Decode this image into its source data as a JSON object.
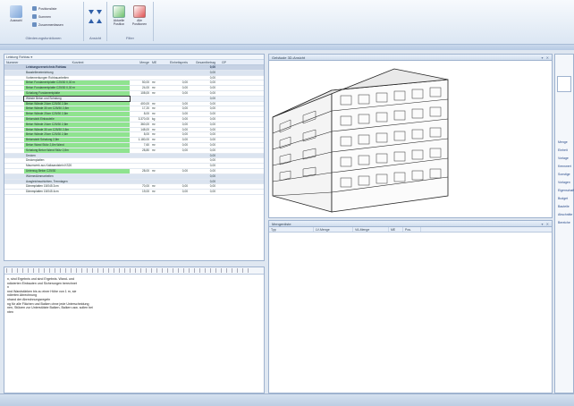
{
  "ribbon": {
    "groups": [
      {
        "label": "Gliederungsfunktionen",
        "big_button": "Auswahl",
        "small_buttons": [
          "Positionsliste",
          "Summen",
          "Zusammenfassen"
        ]
      },
      {
        "label": "Ansicht",
        "small_buttons": [],
        "big_button": ""
      },
      {
        "label": "Filter",
        "big_buttons": [
          "Aktuelle Position",
          "Alle Positionen"
        ]
      }
    ]
  },
  "table_panel": {
    "toolbar_value": "Leistung Rohbau",
    "columns": [
      "Nummer",
      "Kurztext",
      "Menge",
      "ME",
      "Einheitspreis",
      "Gesamtbetrag",
      "GP"
    ],
    "rows": [
      {
        "type": "sec",
        "text": "Leistungsverzeichnis Rohbau",
        "total": "0,00"
      },
      {
        "type": "sub",
        "text": "Baustelleneinrichtung",
        "total": "0,00"
      },
      {
        "type": "plain",
        "text": "Vorbemerkungen Rohbauarbeiten",
        "total": "0,00"
      },
      {
        "type": "grn",
        "text": "Beton Fundamentplatte C25/30 0,30 m",
        "qty": "50,00",
        "unit": "m²",
        "ep": "0,00",
        "total": "0,00"
      },
      {
        "type": "grn",
        "text": "Beton Fundamentplatte C25/30 0,30 m",
        "qty": "24,00",
        "unit": "m²",
        "ep": "0,00",
        "total": "0,00"
      },
      {
        "type": "grn",
        "text": "Schalung Fundamentplatte",
        "qty": "108,00",
        "unit": "m²",
        "ep": "0,00",
        "total": "0,00"
      },
      {
        "type": "sel",
        "text": "Wände Beton und Schalung",
        "total": "0,00"
      },
      {
        "type": "grn",
        "text": "Beton Wände 24cm C25/30 2,8m",
        "qty": "400,00",
        "unit": "m²",
        "ep": "0,00",
        "total": "0,00"
      },
      {
        "type": "grn",
        "text": "Beton Wände 30 cm C25/30 2,8m",
        "qty": "17,20",
        "unit": "m²",
        "ep": "0,00",
        "total": "0,00"
      },
      {
        "type": "grn",
        "text": "Beton Wände 20cm C25/30 2,8m",
        "qty": "8,00",
        "unit": "m²",
        "ep": "0,00",
        "total": "0,00"
      },
      {
        "type": "grn",
        "text": "Betonstahl Einbauteile",
        "qty": "3.370,00",
        "unit": "kg",
        "ep": "0,00",
        "total": "0,00"
      },
      {
        "type": "grn",
        "text": "Beton Wände 24cm C25/30 2,8m",
        "qty": "360,00",
        "unit": "m²",
        "ep": "0,00",
        "total": "0,00"
      },
      {
        "type": "grn",
        "text": "Beton Wände 30 cm C25/30 2,8m",
        "qty": "148,00",
        "unit": "m²",
        "ep": "0,00",
        "total": "0,00"
      },
      {
        "type": "grn",
        "text": "Beton Wände 20cm C25/30 2,8m",
        "qty": "8,00",
        "unit": "m²",
        "ep": "0,00",
        "total": "0,00"
      },
      {
        "type": "grn",
        "text": "Betonstahl Schalung 2,8m",
        "qty": "1.180,00",
        "unit": "m²",
        "ep": "0,00",
        "total": "0,00"
      },
      {
        "type": "grn",
        "text": "Beton Wand Stütz 2,8m Wand",
        "qty": "7,60",
        "unit": "m²",
        "ep": "0,00",
        "total": "0,00"
      },
      {
        "type": "grn",
        "text": "Schalung Beton Wand Stütz 2,8m",
        "qty": "28,80",
        "unit": "m²",
        "ep": "0,00",
        "total": "0,00"
      },
      {
        "type": "sub",
        "text": "Decken",
        "total": "0,00"
      },
      {
        "type": "plain",
        "text": "Deckenplatten",
        "total": "0,00"
      },
      {
        "type": "plain",
        "text": "Mauerwerk aus Kalksandstein KS20",
        "total": "0,00"
      },
      {
        "type": "grn",
        "text": "Unterzug Beton C25/30",
        "qty": "28,00",
        "unit": "m²",
        "ep": "0,00",
        "total": "0,00"
      },
      {
        "type": "sub",
        "text": "Wärmedämmarbeiten",
        "total": "0,00"
      },
      {
        "type": "sub",
        "text": "Ausgleichsschichten, Trennlagen",
        "total": "0,00"
      },
      {
        "type": "plain",
        "text": "Dämmplatten 15/045 2cm",
        "qty": "70,00",
        "unit": "m²",
        "ep": "0,00",
        "total": "0,00"
      },
      {
        "type": "plain",
        "text": "Dämmplatten 15/045 4cm",
        "qty": "19,00",
        "unit": "m²",
        "ep": "0,00",
        "total": "0,00"
      }
    ]
  },
  "editor_panel": {
    "lines": [
      "n, sind Ergebnis und sind Ergebnis. Wand- und",
      "ndizierten Einbauten und Sicherungen berechnet",
      "n",
      "nnd Wandstärken bis zu einer Höhe von 1 m, sie",
      "ndierten Abrechnung",
      "nhand der Abrechnungsregeln",
      "ng für alle Flächen und Balken ohne jede Unterscheidung",
      "nen, Stützen zur Unterstützte Balken, Balken usw. sollen bei",
      "nten"
    ]
  },
  "viewport_panel": {
    "title": "Gebäude 3D-Ansicht"
  },
  "bottom_right_panel": {
    "title": "Mengenliste",
    "columns": [
      "Typ",
      "LV-Menge",
      "VA-Menge",
      "ME",
      "Pos."
    ]
  },
  "side_panel": {
    "items": [
      "Menge",
      "Einheit",
      "Vorlage",
      "Kennwert",
      "Sonstige",
      "Vorlagen",
      "Eigenschaften",
      "Budget",
      "Bauteile",
      "Abschnitte",
      "Bereiche"
    ]
  },
  "colors": {
    "accent": "#8fe38f",
    "header": "#c6d2e4",
    "border": "#9fb3cf"
  }
}
